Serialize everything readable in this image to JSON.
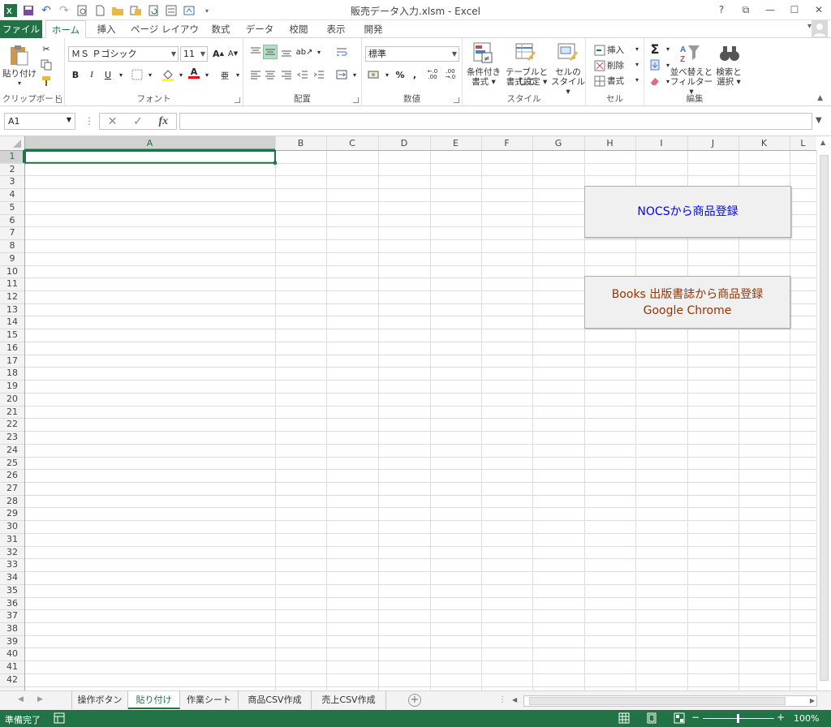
{
  "window": {
    "title": "販売データ入力.xlsm - Excel",
    "controls": [
      "?",
      "⧉",
      "—",
      "☐",
      "✕"
    ]
  },
  "ribbon": {
    "tabs": [
      "ファイル",
      "ホーム",
      "挿入",
      "ページ レイアウト",
      "数式",
      "データ",
      "校閲",
      "表示",
      "開発"
    ],
    "active_tab": "ホーム",
    "clipboard": {
      "label": "クリップボード",
      "paste": "貼り付け"
    },
    "font": {
      "label": "フォント",
      "name": "ＭＳ Ｐゴシック",
      "size": "11"
    },
    "alignment": {
      "label": "配置"
    },
    "number": {
      "label": "数値",
      "format": "標準"
    },
    "styles": {
      "label": "スタイル",
      "conditional_l1": "条件付き",
      "conditional_l2": "書式",
      "table_l1": "テーブルとして",
      "table_l2": "書式設定",
      "cell_l1": "セルの",
      "cell_l2": "スタイル"
    },
    "cells": {
      "label": "セル",
      "insert": "挿入",
      "delete": "削除",
      "format": "書式"
    },
    "editing": {
      "label": "編集",
      "sort_l1": "並べ替えと",
      "sort_l2": "フィルター",
      "find_l1": "検索と",
      "find_l2": "選択"
    }
  },
  "formula_bar": {
    "name_box": "A1",
    "content": "",
    "fx": "fx"
  },
  "columns": [
    "A",
    "B",
    "C",
    "D",
    "E",
    "F",
    "G",
    "H",
    "I",
    "J",
    "K",
    "L"
  ],
  "rows": [
    "1",
    "2",
    "3",
    "4",
    "5",
    "6",
    "7",
    "8",
    "9",
    "10",
    "11",
    "12",
    "13",
    "14",
    "15",
    "16",
    "17",
    "18",
    "19",
    "20",
    "21",
    "22",
    "23",
    "24",
    "25",
    "26",
    "27",
    "28",
    "29",
    "30",
    "31",
    "32",
    "33",
    "34",
    "35",
    "36",
    "37",
    "38",
    "39",
    "40",
    "41",
    "42"
  ],
  "active_cell": "A1",
  "macro_buttons": {
    "nocs": {
      "text": "NOCSから商品登録",
      "color": "#0000ff"
    },
    "books": {
      "line1": "Books 出版書誌から商品登録",
      "line2": "Google Chrome",
      "color": "#993300"
    }
  },
  "sheet_tabs": [
    "操作ボタン",
    "貼り付け",
    "作業シート",
    "商品CSV作成",
    "売上CSV作成"
  ],
  "active_sheet": "貼り付け",
  "status": {
    "ready": "準備完了",
    "zoom": "100%"
  },
  "colors": {
    "excel_green": "#217346"
  }
}
